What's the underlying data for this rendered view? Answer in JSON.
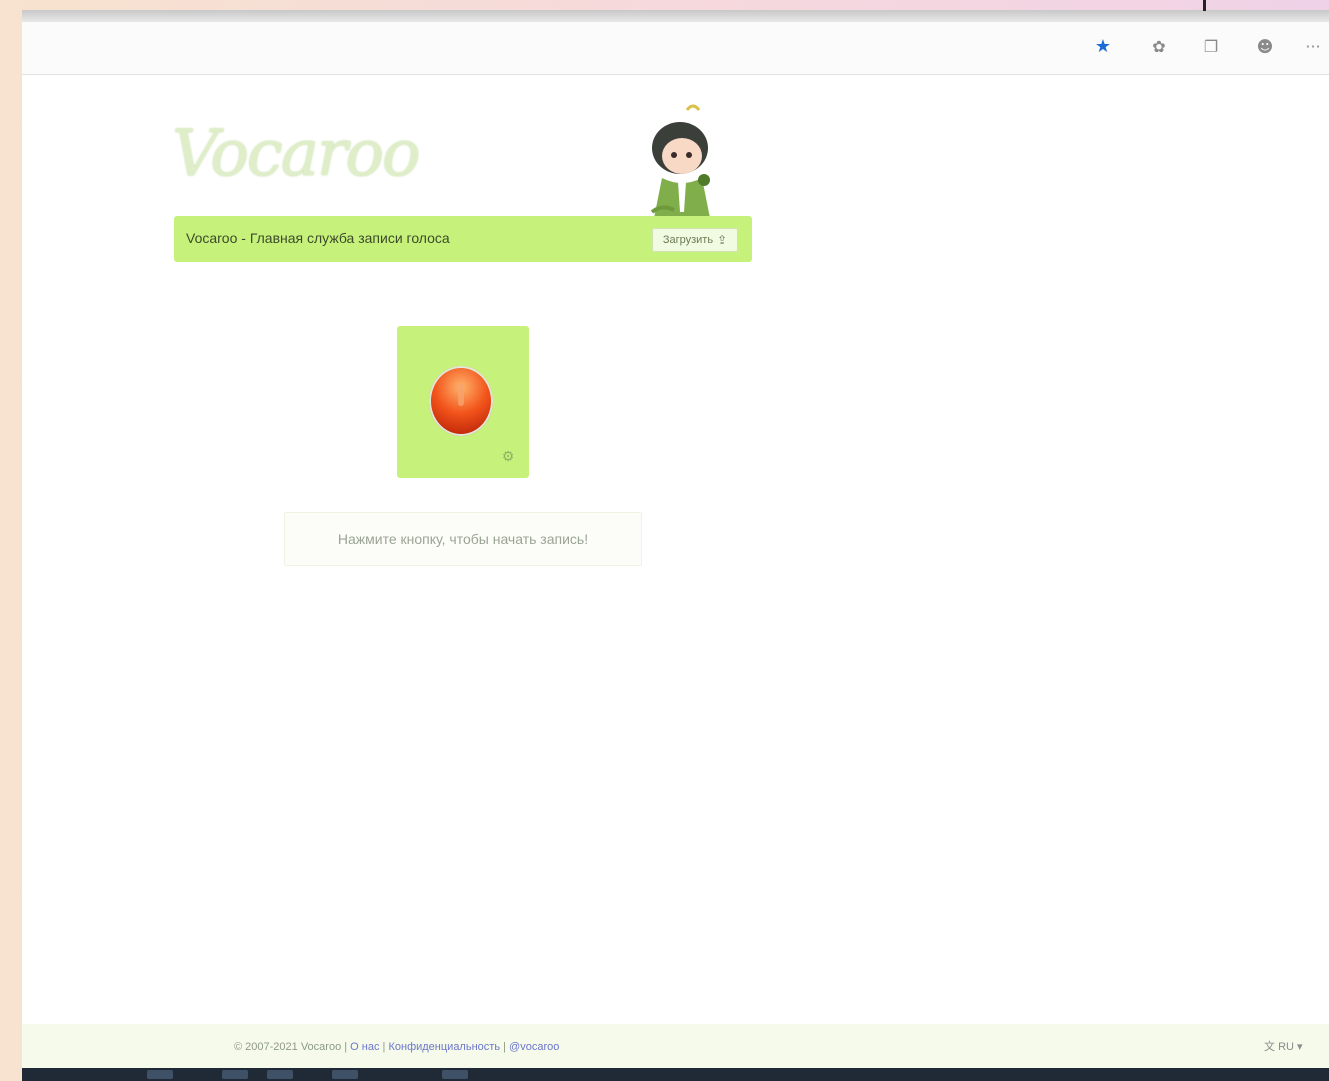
{
  "browser": {
    "toolbar": {
      "icons": [
        "star-icon",
        "extension-icon",
        "collections-icon",
        "profile-icon",
        "more-icon"
      ],
      "more_label": "···"
    }
  },
  "site": {
    "logo_text": "Vocaroo",
    "title": "Vocaroo - Главная служба записи голоса",
    "upload_label": "Загрузить",
    "hint": "Нажмите кнопку, чтобы начать запись!",
    "colors": {
      "accent_green": "#c6f27c",
      "record_red": "#e64a1a"
    }
  },
  "footer": {
    "copyright": "© 2007-2021 Vocaroo",
    "links": [
      "О нас",
      "Конфиденциальность",
      "@vocaroo"
    ],
    "language": "RU"
  }
}
